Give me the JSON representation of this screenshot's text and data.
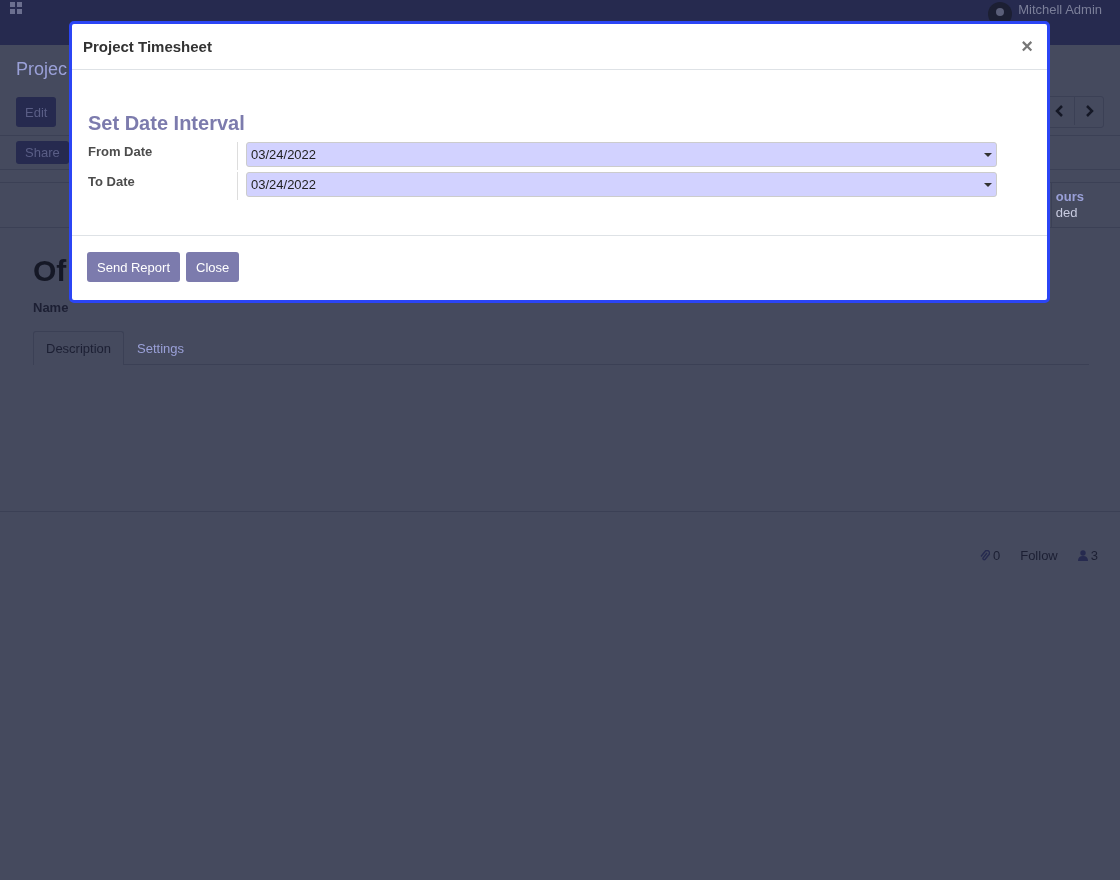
{
  "navbar": {
    "user": "Mitchell Admin"
  },
  "form": {
    "breadcrumb": "Projec",
    "buttons": [
      "Edit",
      "Share"
    ],
    "stat": {
      "line_1": "ours",
      "line_2": "ded"
    },
    "title": "Of",
    "field_label": "Name",
    "tabs": [
      {
        "label": "Description",
        "selected": true
      },
      {
        "label": "Settings",
        "selected": false
      }
    ],
    "chatter": {
      "attachments": "0",
      "follow": "Follow",
      "followers": "3"
    }
  },
  "dialog": {
    "title": "Project Timesheet",
    "close": "×",
    "heading": "Set Date Interval",
    "fields": [
      {
        "label": "From Date",
        "value": "03/24/2022"
      },
      {
        "label": "To Date",
        "value": "03/24/2022"
      }
    ],
    "buttons": [
      "Send Report",
      "Close"
    ]
  }
}
